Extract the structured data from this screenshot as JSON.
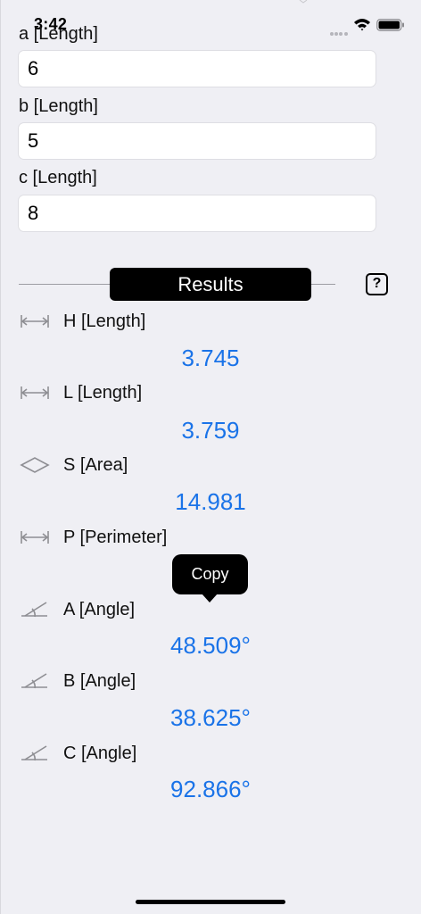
{
  "status_bar": {
    "time": "3:42"
  },
  "inputs": [
    {
      "label": "a [Length]",
      "value": "6"
    },
    {
      "label": "b [Length]",
      "value": "5"
    },
    {
      "label": "c [Length]",
      "value": "8"
    }
  ],
  "results_header": {
    "title": "Results",
    "help_label": "?"
  },
  "results": [
    {
      "icon": "length-measure-icon",
      "label": "H [Length]",
      "value": "3.745"
    },
    {
      "icon": "length-measure-icon",
      "label": "L [Length]",
      "value": "3.759"
    },
    {
      "icon": "area-rhombus-icon",
      "label": "S [Area]",
      "value": "14.981"
    },
    {
      "icon": "length-measure-icon",
      "label": "P [Perimeter]",
      "value": ""
    },
    {
      "icon": "angle-icon",
      "label": "A [Angle]",
      "value": "48.509°"
    },
    {
      "icon": "angle-icon",
      "label": "B [Angle]",
      "value": "38.625°"
    },
    {
      "icon": "angle-icon",
      "label": "C [Angle]",
      "value": "92.866°"
    }
  ],
  "tooltip": {
    "label": "Copy"
  },
  "colors": {
    "background": "#efeff4",
    "value_blue": "#1a73e8",
    "pill": "#000000"
  }
}
